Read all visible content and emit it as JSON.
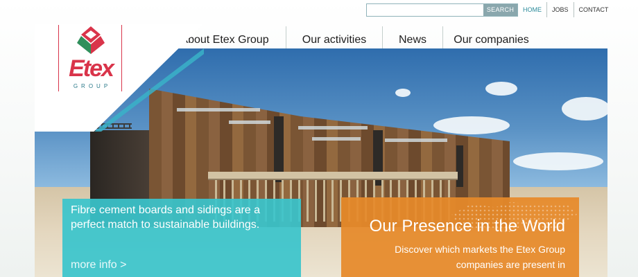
{
  "header": {
    "search": {
      "placeholder": "",
      "value": "",
      "button_label": "SEARCH"
    },
    "util_links": [
      {
        "label": "HOME",
        "active": true
      },
      {
        "label": "JOBS",
        "active": false
      },
      {
        "label": "CONTACT",
        "active": false
      }
    ]
  },
  "nav": {
    "items": [
      {
        "label": "About Etex Group"
      },
      {
        "label": "Our activities"
      },
      {
        "label": "News"
      },
      {
        "label": "Our companies"
      }
    ]
  },
  "logo": {
    "word": "Etex",
    "sub": "GROUP",
    "icon": "etex-diamond-logo-icon"
  },
  "promo_teal": {
    "text": "Fibre cement boards and sidings are a perfect match to sustainable buildings.",
    "link": "more info >"
  },
  "promo_orange": {
    "title": "Our Presence in the World",
    "text": "Discover which markets the Etex Group companies are present in"
  },
  "colors": {
    "brand_red": "#d9344a",
    "teal": "#3ac4cc",
    "orange": "#e68a2a",
    "active_link": "#2a8a9a"
  }
}
